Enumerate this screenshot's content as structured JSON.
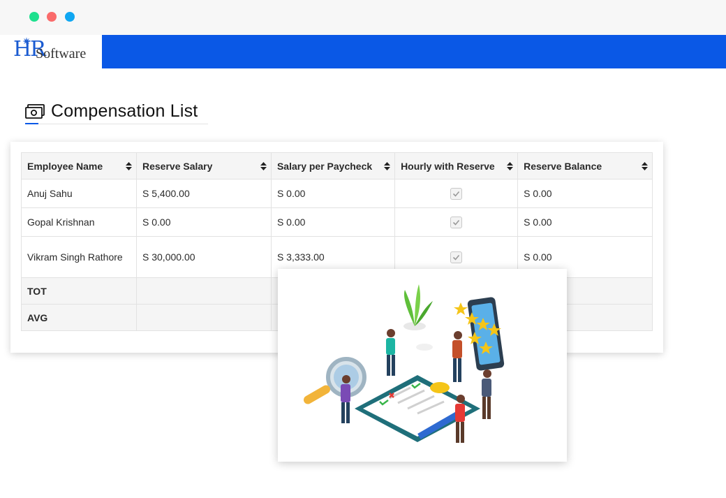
{
  "window": {
    "controls": [
      "green",
      "red",
      "blue"
    ]
  },
  "brand": {
    "logo_mark": "HR",
    "logo_text": "Software",
    "accent_color": "#0a58e6"
  },
  "page": {
    "title": "Compensation List",
    "icon": "money-icon"
  },
  "table": {
    "headers": [
      "Employee Name",
      "Reserve Salary",
      "Salary per Paycheck",
      "Hourly with Reserve",
      "Reserve Balance"
    ],
    "rows": [
      {
        "name": "Anuj Sahu",
        "reserve_salary": "S 5,400.00",
        "per_paycheck": "S 0.00",
        "hourly_reserve": true,
        "reserve_balance": "S 0.00"
      },
      {
        "name": "Gopal Krishnan",
        "reserve_salary": "S 0.00",
        "per_paycheck": "S 0.00",
        "hourly_reserve": true,
        "reserve_balance": "S 0.00"
      },
      {
        "name": "Vikram Singh Rathore",
        "reserve_salary": "S 30,000.00",
        "per_paycheck": "S 3,333.00",
        "hourly_reserve": true,
        "reserve_balance": "S 0.00"
      }
    ],
    "summary": [
      {
        "label": "TOT"
      },
      {
        "label": "AVG"
      }
    ]
  },
  "illustration": {
    "subject": "review-checklist-illustration"
  }
}
